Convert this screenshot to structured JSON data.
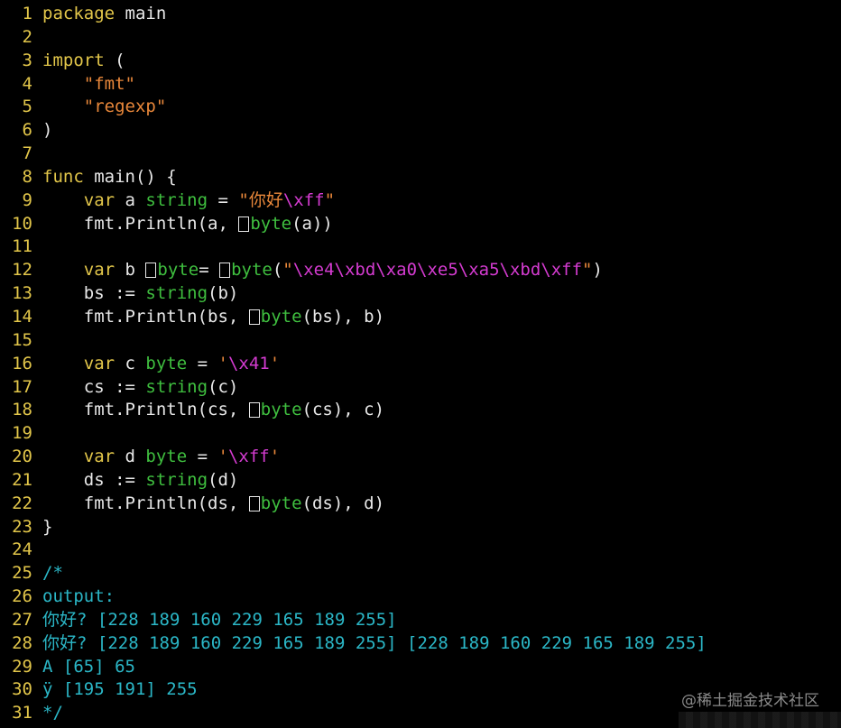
{
  "colors": {
    "background": "#000000",
    "line_number": "#e2c64a",
    "keyword": "#e2c64a",
    "type": "#3fbf3f",
    "string": "#e8873a",
    "escape": "#d43bd0",
    "comment": "#2bb7c7",
    "plain": "#e8e8e8"
  },
  "editor": {
    "lines": [
      {
        "n": "1",
        "tokens": [
          [
            "kw",
            "package"
          ],
          [
            "plain",
            " main"
          ]
        ]
      },
      {
        "n": "2",
        "tokens": []
      },
      {
        "n": "3",
        "tokens": [
          [
            "kw",
            "import"
          ],
          [
            "plain",
            " ("
          ]
        ]
      },
      {
        "n": "4",
        "tokens": [
          [
            "plain",
            "    "
          ],
          [
            "str",
            "\"fmt\""
          ]
        ]
      },
      {
        "n": "5",
        "tokens": [
          [
            "plain",
            "    "
          ],
          [
            "str",
            "\"regexp\""
          ]
        ]
      },
      {
        "n": "6",
        "tokens": [
          [
            "plain",
            ")"
          ]
        ]
      },
      {
        "n": "7",
        "tokens": []
      },
      {
        "n": "8",
        "tokens": [
          [
            "kw",
            "func"
          ],
          [
            "plain",
            " main() {"
          ]
        ]
      },
      {
        "n": "9",
        "tokens": [
          [
            "plain",
            "    "
          ],
          [
            "kw",
            "var"
          ],
          [
            "plain",
            " a "
          ],
          [
            "type",
            "string"
          ],
          [
            "plain",
            " = "
          ],
          [
            "str",
            "\"你好"
          ],
          [
            "esc",
            "\\xff"
          ],
          [
            "str",
            "\""
          ]
        ]
      },
      {
        "n": "10",
        "tokens": [
          [
            "plain",
            "    fmt.Println(a, "
          ],
          [
            "box",
            ""
          ],
          [
            "type",
            "byte"
          ],
          [
            "plain",
            "(a))"
          ]
        ]
      },
      {
        "n": "11",
        "tokens": []
      },
      {
        "n": "12",
        "tokens": [
          [
            "plain",
            "    "
          ],
          [
            "kw",
            "var"
          ],
          [
            "plain",
            " b "
          ],
          [
            "box",
            ""
          ],
          [
            "type",
            "byte"
          ],
          [
            "plain",
            "= "
          ],
          [
            "box",
            ""
          ],
          [
            "type",
            "byte"
          ],
          [
            "plain",
            "("
          ],
          [
            "str",
            "\""
          ],
          [
            "esc",
            "\\xe4\\xbd\\xa0\\xe5\\xa5\\xbd\\xff"
          ],
          [
            "str",
            "\""
          ],
          [
            "plain",
            ")"
          ]
        ]
      },
      {
        "n": "13",
        "tokens": [
          [
            "plain",
            "    bs := "
          ],
          [
            "type",
            "string"
          ],
          [
            "plain",
            "(b)"
          ]
        ]
      },
      {
        "n": "14",
        "tokens": [
          [
            "plain",
            "    fmt.Println(bs, "
          ],
          [
            "box",
            ""
          ],
          [
            "type",
            "byte"
          ],
          [
            "plain",
            "(bs), b)"
          ]
        ]
      },
      {
        "n": "15",
        "tokens": []
      },
      {
        "n": "16",
        "tokens": [
          [
            "plain",
            "    "
          ],
          [
            "kw",
            "var"
          ],
          [
            "plain",
            " c "
          ],
          [
            "type",
            "byte"
          ],
          [
            "plain",
            " = "
          ],
          [
            "str",
            "'"
          ],
          [
            "esc",
            "\\x41"
          ],
          [
            "str",
            "'"
          ]
        ]
      },
      {
        "n": "17",
        "tokens": [
          [
            "plain",
            "    cs := "
          ],
          [
            "type",
            "string"
          ],
          [
            "plain",
            "(c)"
          ]
        ]
      },
      {
        "n": "18",
        "tokens": [
          [
            "plain",
            "    fmt.Println(cs, "
          ],
          [
            "box",
            ""
          ],
          [
            "type",
            "byte"
          ],
          [
            "plain",
            "(cs), c)"
          ]
        ]
      },
      {
        "n": "19",
        "tokens": []
      },
      {
        "n": "20",
        "tokens": [
          [
            "plain",
            "    "
          ],
          [
            "kw",
            "var"
          ],
          [
            "plain",
            " d "
          ],
          [
            "type",
            "byte"
          ],
          [
            "plain",
            " = "
          ],
          [
            "str",
            "'"
          ],
          [
            "esc",
            "\\xff"
          ],
          [
            "str",
            "'"
          ]
        ]
      },
      {
        "n": "21",
        "tokens": [
          [
            "plain",
            "    ds := "
          ],
          [
            "type",
            "string"
          ],
          [
            "plain",
            "(d)"
          ]
        ]
      },
      {
        "n": "22",
        "tokens": [
          [
            "plain",
            "    fmt.Println(ds, "
          ],
          [
            "box",
            ""
          ],
          [
            "type",
            "byte"
          ],
          [
            "plain",
            "(ds), d)"
          ]
        ]
      },
      {
        "n": "23",
        "tokens": [
          [
            "plain",
            "}"
          ]
        ]
      },
      {
        "n": "24",
        "tokens": []
      },
      {
        "n": "25",
        "tokens": [
          [
            "cmt",
            "/*"
          ]
        ]
      },
      {
        "n": "26",
        "tokens": [
          [
            "cmt",
            "output:"
          ]
        ]
      },
      {
        "n": "27",
        "tokens": [
          [
            "cmt",
            "你好? [228 189 160 229 165 189 255]"
          ]
        ]
      },
      {
        "n": "28",
        "tokens": [
          [
            "cmt",
            "你好? [228 189 160 229 165 189 255] [228 189 160 229 165 189 255]"
          ]
        ]
      },
      {
        "n": "29",
        "tokens": [
          [
            "cmt",
            "A [65] 65"
          ]
        ]
      },
      {
        "n": "30",
        "tokens": [
          [
            "cmt",
            "ÿ [195 191] 255"
          ]
        ]
      },
      {
        "n": "31",
        "tokens": [
          [
            "cmt",
            "*/"
          ]
        ]
      }
    ]
  },
  "watermark": {
    "text": "@稀土掘金技术社区"
  }
}
